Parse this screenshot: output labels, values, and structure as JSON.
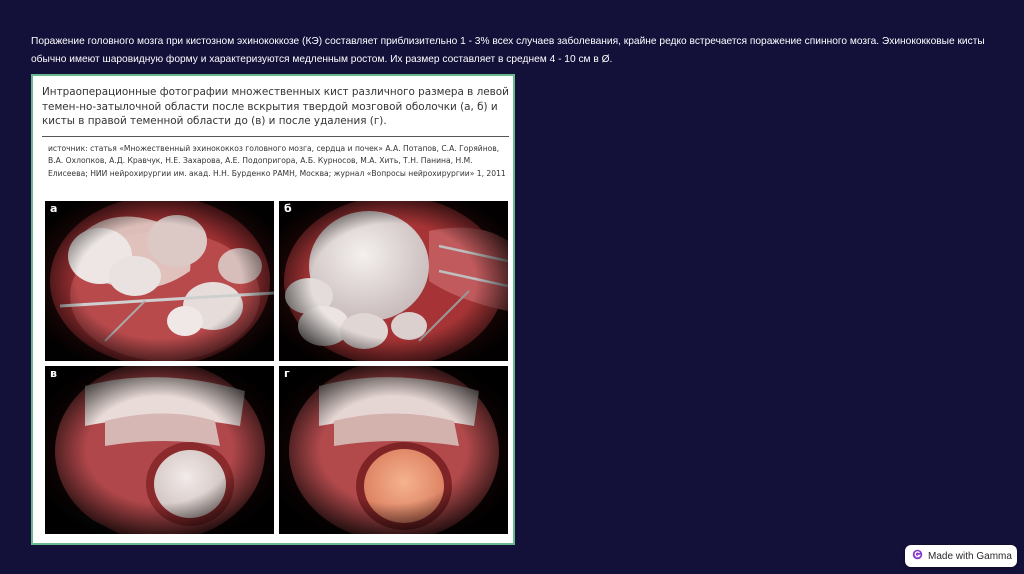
{
  "slide": {
    "intro_text": "Поражение головного мозга при кистозном эхинококкозе (КЭ) составляет приблизительно 1 - 3% всех случаев заболевания, крайне редко встречается поражение спинного мозга. Эхинококковые кисты обычно имеют шаровидную форму и характеризуются медленным ростом. Их размер составляет в среднем 4 - 10 см в Ø."
  },
  "figure": {
    "caption": "Интраоперационные фотографии множественных кист различного размера в левой темен-но-затылочной области после вскрытия твердой мозговой оболочки (а, б) и кисты в правой теменной области до (в) и после удаления (г).",
    "source": "источник: статья «Множественный эхинококкоз головного мозга, сердца и почек» А.А. Потапов, С.А. Горяйнов, В.А. Охлопков, А.Д. Кравчук, Н.Е. Захарова, А.Е. Подопригора, А.Б. Курносов, М.А. Хить, Т.Н. Панина, Н.М. Елисеева; НИИ нейрохирургии им. акад. Н.Н. Бурденко РАМН, Москва; журнал «Вопросы нейрохирургии» 1, 2011",
    "photos": [
      {
        "label": "а"
      },
      {
        "label": "б"
      },
      {
        "label": "в"
      },
      {
        "label": "г"
      }
    ]
  },
  "badge": {
    "label": "Made with Gamma",
    "icon": "gamma-logo-icon",
    "accent_color": "#8a3cc8"
  },
  "colors": {
    "background": "#13103a",
    "card_border": "#6ab890"
  }
}
